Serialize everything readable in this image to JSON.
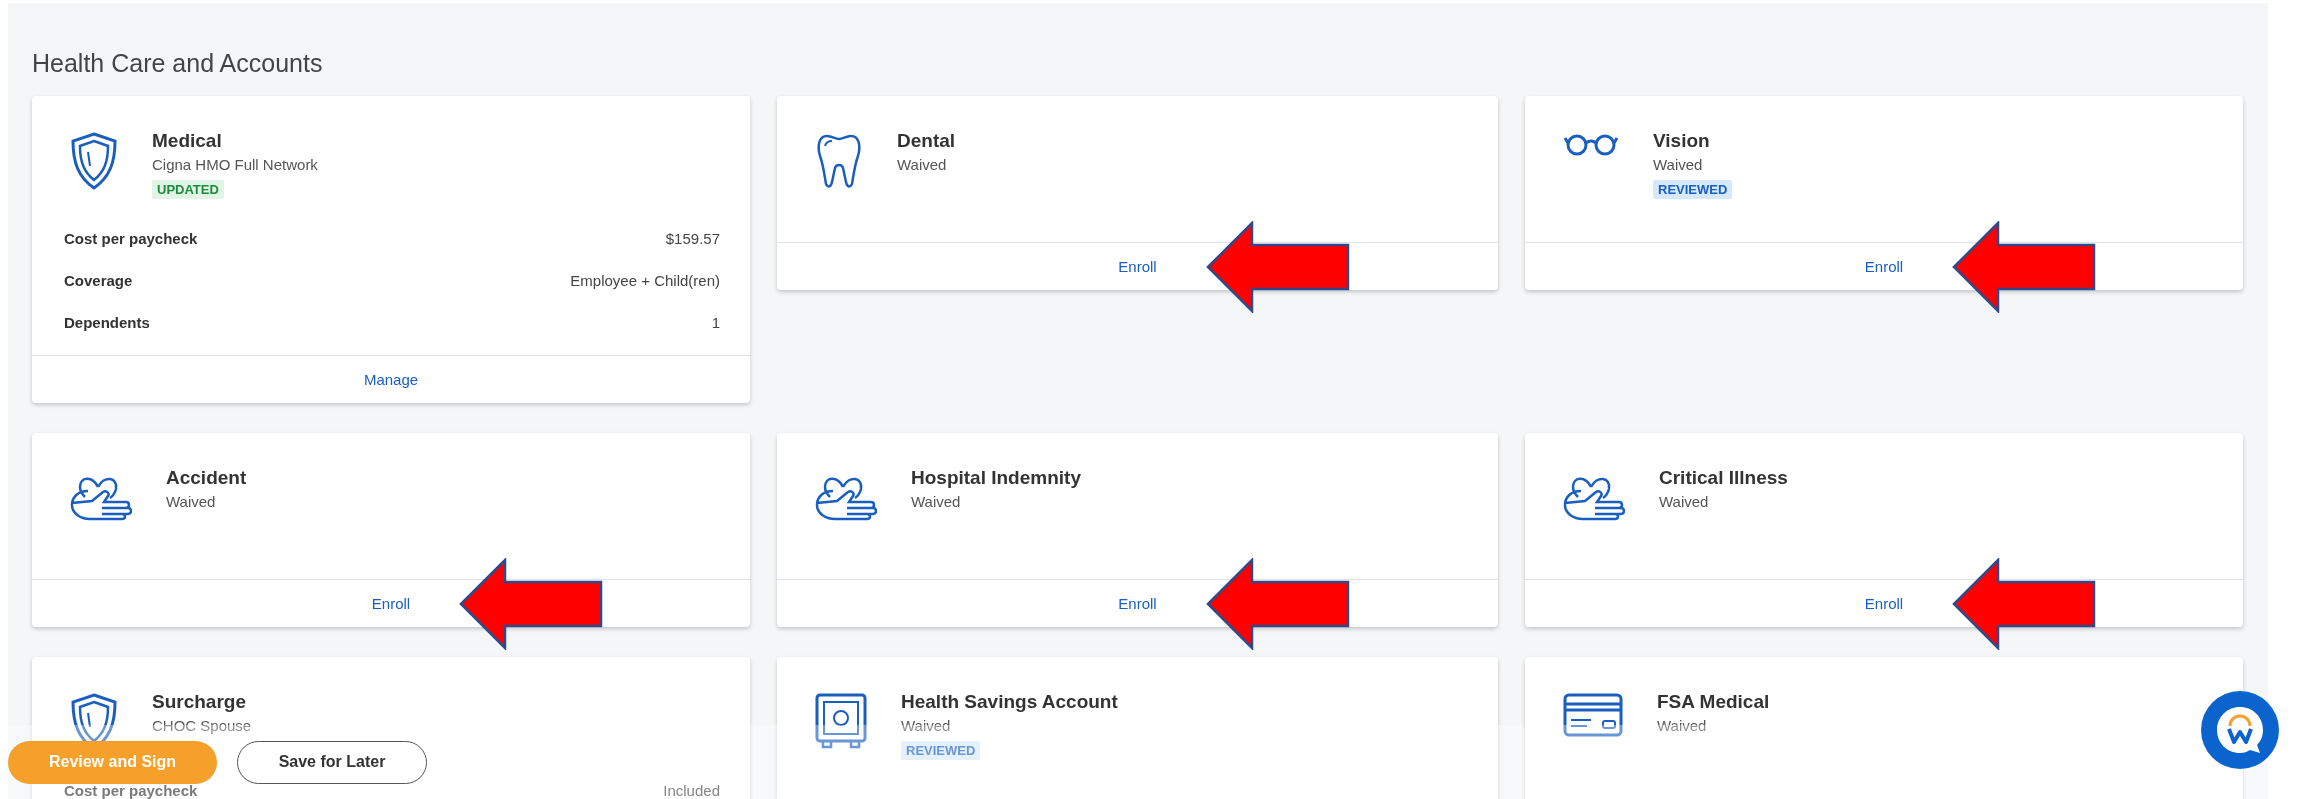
{
  "section": {
    "title": "Health Care and Accounts"
  },
  "cards": [
    {
      "kind": "shield",
      "title": "Medical",
      "subtitle": "Cigna HMO Full Network",
      "badge": {
        "label": "UPDATED",
        "kind": "updated"
      },
      "details": [
        {
          "label": "Cost per paycheck",
          "value": "$159.57"
        },
        {
          "label": "Coverage",
          "value": "Employee + Child(ren)"
        },
        {
          "label": "Dependents",
          "value": "1"
        }
      ],
      "action": "Manage",
      "annotated": false
    },
    {
      "kind": "tooth",
      "title": "Dental",
      "subtitle": "Waived",
      "action": "Enroll",
      "annotated": true
    },
    {
      "kind": "glasses",
      "title": "Vision",
      "subtitle": "Waived",
      "badge": {
        "label": "REVIEWED",
        "kind": "reviewed"
      },
      "action": "Enroll",
      "annotated": true
    },
    {
      "kind": "heart-hand",
      "title": "Accident",
      "subtitle": "Waived",
      "action": "Enroll",
      "annotated": true
    },
    {
      "kind": "heart-hand",
      "title": "Hospital Indemnity",
      "subtitle": "Waived",
      "action": "Enroll",
      "annotated": true
    },
    {
      "kind": "heart-hand",
      "title": "Critical Illness",
      "subtitle": "Waived",
      "action": "Enroll",
      "annotated": true
    },
    {
      "kind": "shield",
      "title": "Surcharge",
      "subtitle": "CHOC Spouse",
      "details": [
        {
          "label": "Cost per paycheck",
          "value": "Included"
        }
      ],
      "annotated": false
    },
    {
      "kind": "safe",
      "title": "Health Savings Account",
      "subtitle": "Waived",
      "badge": {
        "label": "REVIEWED",
        "kind": "reviewed"
      },
      "annotated": false
    },
    {
      "kind": "card",
      "title": "FSA Medical",
      "subtitle": "Waived",
      "annotated": false
    }
  ],
  "bottom_bar": {
    "buttons": [
      {
        "label": "Review and Sign",
        "kind": "primary"
      },
      {
        "label": "Save for Later",
        "kind": "secondary"
      }
    ]
  }
}
